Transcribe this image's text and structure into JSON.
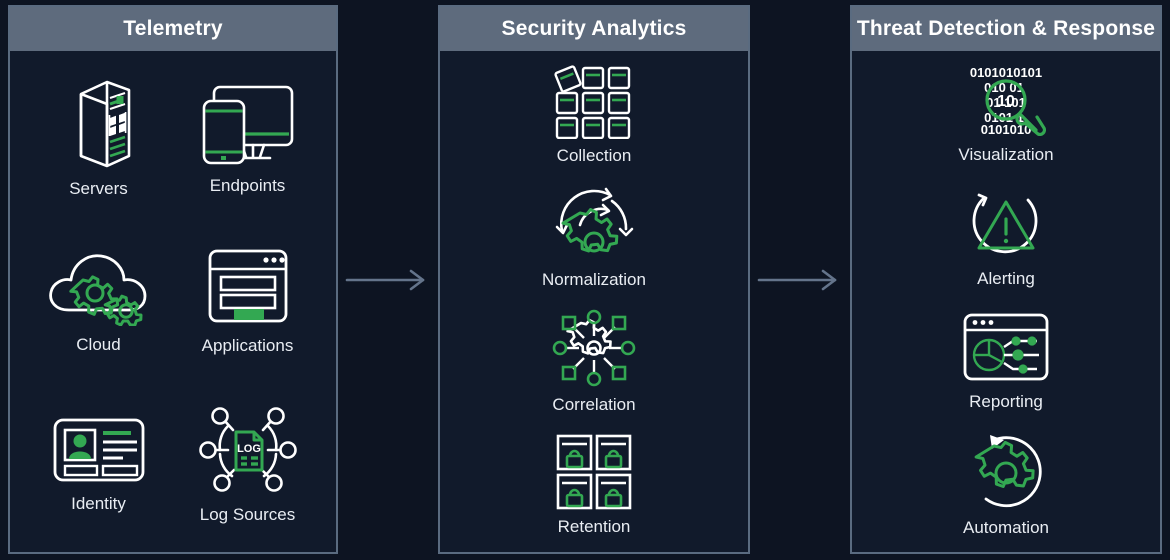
{
  "diagram": {
    "title_colors": {
      "background": "#0d1422",
      "panel_fill": "#111a2b",
      "panel_border": "#5a6b80",
      "header_fill": "#5e6b7d",
      "header_text": "#ffffff",
      "label_text": "#e9edf3",
      "accent_green": "#33a852",
      "icon_white": "#ffffff",
      "arrow_gray": "#64748b"
    },
    "columns": [
      {
        "id": "telemetry",
        "header": "Telemetry",
        "layout": "2-column-grid",
        "items": [
          {
            "label": "Servers",
            "icon": "server-rack-icon"
          },
          {
            "label": "Endpoints",
            "icon": "monitor-phone-icon"
          },
          {
            "label": "Cloud",
            "icon": "cloud-gears-icon"
          },
          {
            "label": "Applications",
            "icon": "application-window-icon"
          },
          {
            "label": "Identity",
            "icon": "id-card-icon"
          },
          {
            "label": "Log Sources",
            "icon": "log-network-icon"
          }
        ]
      },
      {
        "id": "security-analytics",
        "header": "Security Analytics",
        "layout": "single-column",
        "items": [
          {
            "label": "Collection",
            "icon": "grid-collection-icon"
          },
          {
            "label": "Normalization",
            "icon": "gear-cycle-icon"
          },
          {
            "label": "Correlation",
            "icon": "node-network-gear-icon"
          },
          {
            "label": "Retention",
            "icon": "locked-archive-icon"
          }
        ]
      },
      {
        "id": "threat-detection-response",
        "header": "Threat Detection & Response",
        "layout": "single-column",
        "items": [
          {
            "label": "Visualization",
            "icon": "binary-magnifier-icon"
          },
          {
            "label": "Alerting",
            "icon": "warning-triangle-icon"
          },
          {
            "label": "Reporting",
            "icon": "report-dashboard-icon"
          },
          {
            "label": "Automation",
            "icon": "automation-gear-icon"
          }
        ]
      }
    ],
    "arrows": [
      {
        "id": "arrow-telemetry-to-analytics",
        "direction": "right"
      },
      {
        "id": "arrow-analytics-to-response",
        "direction": "right"
      }
    ]
  }
}
